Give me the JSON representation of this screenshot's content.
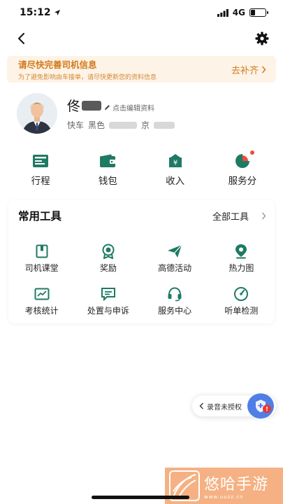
{
  "status_bar": {
    "time": "15:12",
    "network": "4G",
    "battery_level": 0.3
  },
  "nav": {
    "back_icon": "chevron-left-icon",
    "settings_icon": "gear-icon"
  },
  "notice": {
    "title": "请尽快完善司机信息",
    "subtitle": "为了避免影响由车接单，请尽快更新您的资料信息",
    "action": "去补齐"
  },
  "profile": {
    "name": "佟",
    "edit_label": "点击编辑资料",
    "service_type": "快车",
    "car_color": "黑色",
    "plate_partial": "京"
  },
  "quick_actions": [
    {
      "label": "行程",
      "icon": "trip-list-icon",
      "badge": false
    },
    {
      "label": "钱包",
      "icon": "wallet-icon",
      "badge": false
    },
    {
      "label": "收入",
      "icon": "income-icon",
      "badge": false
    },
    {
      "label": "服务分",
      "icon": "service-score-icon",
      "badge": true
    }
  ],
  "tools": {
    "title": "常用工具",
    "all_label": "全部工具",
    "items": [
      {
        "label": "司机课堂",
        "icon": "book-icon"
      },
      {
        "label": "奖励",
        "icon": "medal-icon"
      },
      {
        "label": "高德活动",
        "icon": "paper-plane-icon"
      },
      {
        "label": "热力图",
        "icon": "map-pin-icon"
      },
      {
        "label": "考核统计",
        "icon": "chart-icon"
      },
      {
        "label": "处置与申诉",
        "icon": "message-icon"
      },
      {
        "label": "服务中心",
        "icon": "headset-icon"
      },
      {
        "label": "听单检测",
        "icon": "gauge-icon"
      }
    ]
  },
  "floating": {
    "recording_label": "录音未授权",
    "badge": "!"
  },
  "watermark": {
    "title": "悠哈手游",
    "url": "www.uuzz.cn"
  },
  "colors": {
    "accent": "#1f7a64",
    "warning": "#d37a1c",
    "notice_bg": "#fdf3e6",
    "red": "#ef4a3c",
    "shield": "#4f7fe6"
  }
}
